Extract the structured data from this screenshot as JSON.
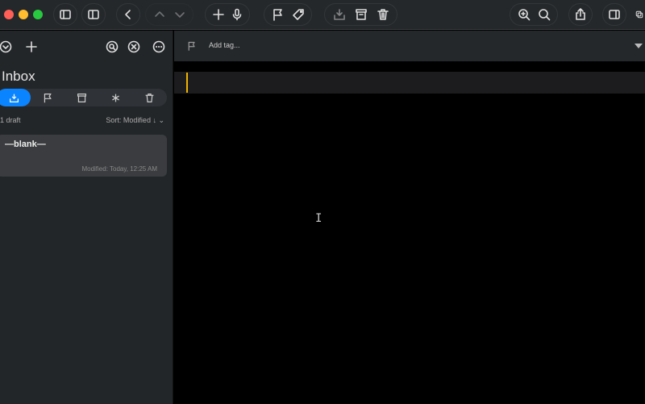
{
  "window": {
    "traffic_lights": {
      "close": "#ff5f57",
      "minimize": "#febc2e",
      "zoom": "#28c840"
    }
  },
  "sidebar": {
    "title": "Inbox",
    "draft_count": "1 draft",
    "sort_label": "Sort: Modified ↓ ⌄",
    "filters": [
      {
        "icon": "inbox-icon",
        "active": true
      },
      {
        "icon": "flag-icon"
      },
      {
        "icon": "archive-icon"
      },
      {
        "icon": "asterisk-icon"
      },
      {
        "icon": "trash-icon"
      }
    ],
    "drafts": [
      {
        "title": "—blank—",
        "modified": "Modified: Today, 12:25 AM"
      }
    ]
  },
  "editor": {
    "tag_placeholder": "Add tag...",
    "caret_color": "#f0b400"
  },
  "colors": {
    "accent": "#0a84ff"
  }
}
